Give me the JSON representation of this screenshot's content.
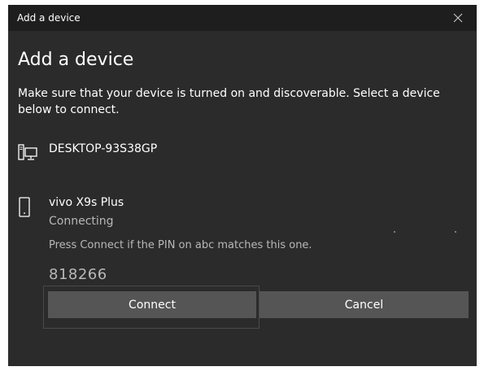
{
  "window": {
    "title": "Add a device",
    "close_icon": "close-icon"
  },
  "main": {
    "heading": "Add a device",
    "instructions": "Make sure that your device is turned on and discoverable. Select a device below to connect."
  },
  "devices": [
    {
      "name": "DESKTOP-93S38GP",
      "icon": "desktop-computer-icon"
    },
    {
      "name": "vivo X9s Plus",
      "icon": "mobile-phone-icon",
      "status": "Connecting",
      "pin_prompt": "Press Connect if the PIN on abc matches this one.",
      "pin": "818266"
    }
  ],
  "buttons": {
    "connect_label": "Connect",
    "cancel_label": "Cancel"
  },
  "colors": {
    "background": "#2b2b2b",
    "titlebar": "#1e1e1e",
    "button": "#555555",
    "secondary_text": "#b8b8b8"
  }
}
